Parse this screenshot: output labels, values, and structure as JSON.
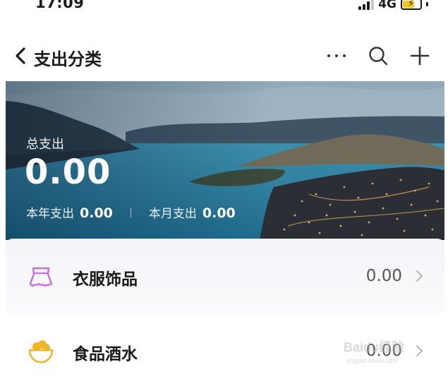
{
  "status_bar": {
    "time": "17:09",
    "network": "4G",
    "icons": [
      "signal-icon",
      "battery-charging-icon"
    ]
  },
  "nav": {
    "title": "支出分类",
    "icons": [
      "back-chevron-icon",
      "more-icon",
      "search-icon",
      "plus-icon"
    ]
  },
  "summary": {
    "total_label": "总支出",
    "total_value": "0.00",
    "year_label": "本年支出",
    "year_value": "0.00",
    "month_label": "本月支出",
    "month_value": "0.00"
  },
  "categories": [
    {
      "name": "衣服饰品",
      "amount": "0.00",
      "icon": "clothing-icon",
      "icon_color": "#c96ee0"
    },
    {
      "name": "食品酒水",
      "amount": "0.00",
      "icon": "food-bowl-icon",
      "icon_color": "#f0b429"
    }
  ],
  "watermark": {
    "text": "Baidu经验",
    "sub": "jingyan.baidu.com"
  }
}
